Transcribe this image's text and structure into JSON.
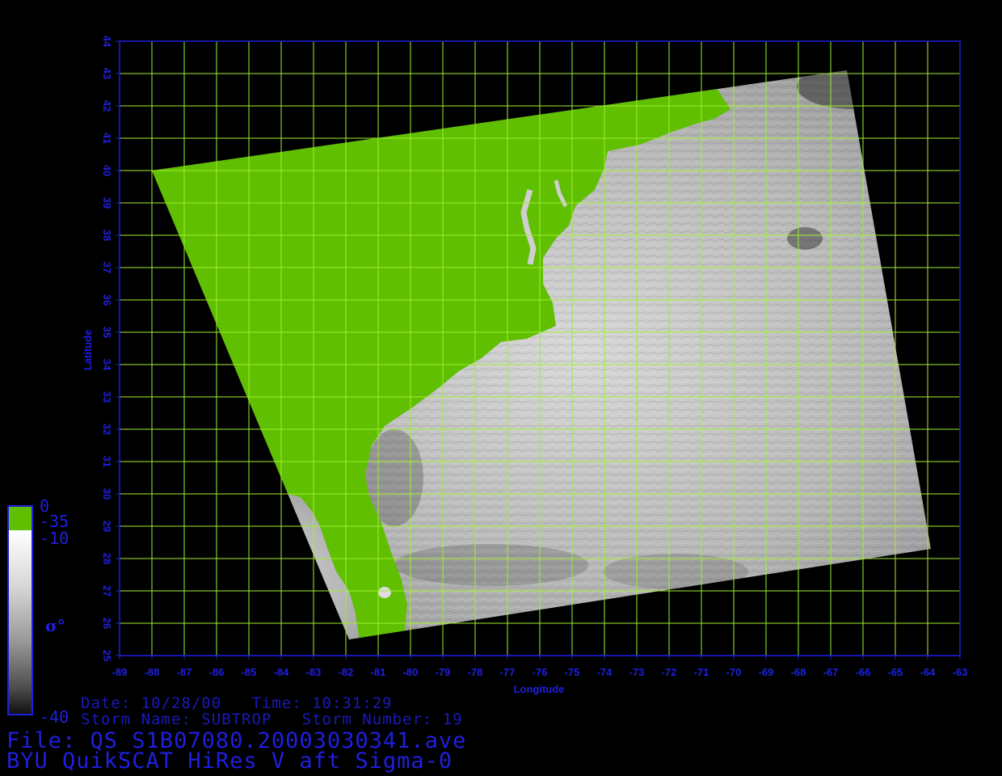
{
  "map": {
    "xlabel": "Longitude",
    "ylabel": "Latitude",
    "lon_range": [
      -89,
      -63
    ],
    "lat_range": [
      25,
      44
    ],
    "lon_ticks": [
      "-89",
      "-88",
      "-87",
      "-86",
      "-85",
      "-84",
      "-83",
      "-82",
      "-81",
      "-80",
      "-79",
      "-78",
      "-77",
      "-76",
      "-75",
      "-74",
      "-73",
      "-72",
      "-71",
      "-70",
      "-69",
      "-68",
      "-67",
      "-66",
      "-65",
      "-64",
      "-63"
    ],
    "lat_ticks": [
      "25",
      "26",
      "27",
      "28",
      "29",
      "30",
      "31",
      "32",
      "33",
      "34",
      "35",
      "36",
      "37",
      "38",
      "39",
      "40",
      "41",
      "42",
      "43",
      "44"
    ],
    "grid": true,
    "swath_corners_lonlat": [
      [
        -88,
        40.0
      ],
      [
        -66.5,
        43.1
      ],
      [
        -63.9,
        28.3
      ],
      [
        -81.9,
        25.5
      ]
    ],
    "coastline_lonlat": [
      [
        -81.6,
        25.6
      ],
      [
        -81.7,
        26.3
      ],
      [
        -81.9,
        27.0
      ],
      [
        -82.3,
        27.6
      ],
      [
        -82.6,
        28.4
      ],
      [
        -82.8,
        29.0
      ],
      [
        -83.0,
        29.4
      ],
      [
        -83.4,
        29.9
      ],
      [
        -84.2,
        30.1
      ],
      [
        -84.6,
        29.9
      ],
      [
        -85.0,
        29.6
      ],
      [
        -85.4,
        29.7
      ],
      [
        -85.6,
        30.0
      ],
      [
        -86.2,
        30.3
      ]
    ],
    "east_coastline_lonlat": [
      [
        -80.2,
        25.6
      ],
      [
        -80.1,
        26.6
      ],
      [
        -80.3,
        27.4
      ],
      [
        -80.6,
        28.2
      ],
      [
        -80.9,
        29.1
      ],
      [
        -81.3,
        30.0
      ],
      [
        -81.4,
        30.6
      ],
      [
        -81.2,
        31.5
      ],
      [
        -80.8,
        32.1
      ],
      [
        -79.9,
        32.7
      ],
      [
        -79.1,
        33.3
      ],
      [
        -78.5,
        33.8
      ],
      [
        -77.8,
        34.2
      ],
      [
        -77.2,
        34.7
      ],
      [
        -76.4,
        34.8
      ],
      [
        -75.5,
        35.2
      ],
      [
        -75.6,
        35.9
      ],
      [
        -75.9,
        36.5
      ],
      [
        -75.9,
        37.3
      ],
      [
        -75.5,
        37.9
      ],
      [
        -75.1,
        38.3
      ],
      [
        -74.9,
        38.9
      ],
      [
        -74.3,
        39.4
      ],
      [
        -74.0,
        40.1
      ],
      [
        -73.9,
        40.6
      ],
      [
        -72.9,
        40.8
      ],
      [
        -71.9,
        41.2
      ],
      [
        -71.0,
        41.5
      ],
      [
        -70.6,
        41.6
      ],
      [
        -70.1,
        41.9
      ],
      [
        -70.5,
        42.5
      ],
      [
        -70.7,
        43.0
      ]
    ]
  },
  "colorbar": {
    "land_max": "0",
    "land_min": "-35",
    "sea_max": "-10",
    "sea_min": "-40",
    "symbol": "σ°",
    "land_color": "#5fbf00"
  },
  "info": {
    "date_line": "Date: 10/28/00   Time: 10:31:29",
    "storm_line": "Storm Name: SUBTROP   Storm Number: 19",
    "file_line": "File: QS_S1B07080.20003030341.ave",
    "product_line": "BYU QuikSCAT HiRes V aft Sigma-0"
  },
  "colors": {
    "axis": "#1f1fe0",
    "grid": "#9fef2f",
    "land": "#5fbf00"
  }
}
